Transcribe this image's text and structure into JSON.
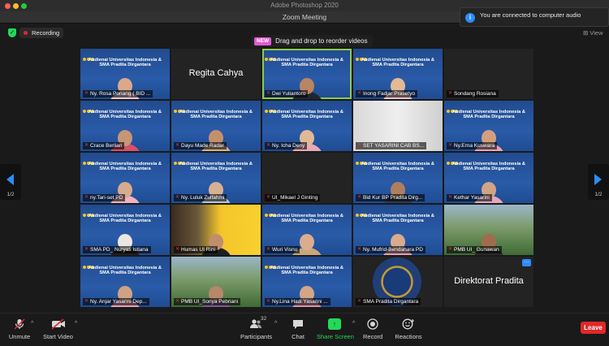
{
  "photoshop": {
    "title": "Adobe Photoshop 2020"
  },
  "window": {
    "title": "Zoom Meeting"
  },
  "notification": {
    "message_line1": "You are connected to computer audio",
    "icon": "info-icon"
  },
  "status": {
    "recording_label": "Recording",
    "view_label": "View",
    "security_icon": "shield-check-icon"
  },
  "tooltip": {
    "badge": "NEW",
    "text": "Drag and drop to reorder videos"
  },
  "banner": {
    "line1": "Audienai Universitas Indonesia &",
    "line2": "SMA Pradita Dirgantara"
  },
  "pagination": {
    "left": "1/2",
    "right": "1/2"
  },
  "tiles": [
    {
      "name": "Ny. Rosa Ponang ( BID ...",
      "kind": "banner",
      "skin": "#d9a98a",
      "cloth": "#e8c7d1"
    },
    {
      "name": "Regita Cahya",
      "kind": "name"
    },
    {
      "name": "Dwi Yuliantoro",
      "kind": "banner",
      "skin": "#b98562",
      "cloth": "#1e2634",
      "active": true
    },
    {
      "name": "Inong Fadjar Prasetyo",
      "kind": "banner",
      "skin": "#e3b996",
      "cloth": "#f1c1c8"
    },
    {
      "name": "Sondang Rosiana",
      "kind": "blank"
    },
    {
      "name": "Crace Berlian",
      "kind": "banner",
      "skin": "#c89578",
      "cloth": "#d4526b"
    },
    {
      "name": "Dayu Made Radar",
      "kind": "banner",
      "skin": "#c48f6d",
      "cloth": "#d6b18a"
    },
    {
      "name": "Ny. Icha Deny",
      "kind": "banner",
      "skin": "#e1b896",
      "cloth": "#e9a8b9"
    },
    {
      "name": "SET YASARINI CAB BS...",
      "kind": "white"
    },
    {
      "name": "Ny.Erna Kuswara",
      "kind": "banner",
      "skin": "#d3a07f",
      "cloth": "#e7a4b8"
    },
    {
      "name": "ny.Tari-set PD",
      "kind": "banner",
      "skin": "#d7ab8d",
      "cloth": "#f0b3c4"
    },
    {
      "name": "Ny. Luluk Zulfahmi",
      "kind": "banner",
      "skin": "#d9b092",
      "cloth": "#b9c6cf"
    },
    {
      "name": "UI_Mikael J Ginting",
      "kind": "blank"
    },
    {
      "name": "Bid Kur BP Pradita Dirg...",
      "kind": "banner",
      "skin": "#b07e5e",
      "cloth": "#2f3b52"
    },
    {
      "name": "Kethar Yasarini",
      "kind": "banner",
      "skin": "#d1a486",
      "cloth": "#e6a7bd"
    },
    {
      "name": "SMA PD_ Nuryati Istiana",
      "kind": "banner",
      "skin": "#ede5e2",
      "cloth": "#202020"
    },
    {
      "name": "Humas UI Rini",
      "kind": "yellow",
      "skin": "#c08e6d",
      "cloth": "#1f1f1f"
    },
    {
      "name": "Wuri Visnu",
      "kind": "banner",
      "skin": "#d9ad8e",
      "cloth": "#c9a77a"
    },
    {
      "name": "Ny. Mufrid-Bendahara PD",
      "kind": "banner",
      "skin": "#d9ac8d",
      "cloth": "#e4a3b5"
    },
    {
      "name": "PMB UI_ Gunawan",
      "kind": "green",
      "skin": "#9f6d4e",
      "cloth": "#2a2a2a"
    },
    {
      "name": "Ny. Anjar Yasarini Dep...",
      "kind": "banner",
      "skin": "#d0a283",
      "cloth": "#ec9fb9"
    },
    {
      "name": "PMB UI_Sonya Pebriani",
      "kind": "green",
      "skin": "#b7876a",
      "cloth": "#7b5b8c"
    },
    {
      "name": "Ny.Lina Hadi Yasarini ...",
      "kind": "banner",
      "skin": "#d4a687",
      "cloth": "#dc94ad"
    },
    {
      "name": "SMA Pradita Dirgantara",
      "kind": "emblem"
    },
    {
      "name": "Direktorat Pradita",
      "kind": "name",
      "more": true
    }
  ],
  "toolbar": {
    "unmute": "Unmute",
    "start_video": "Start Video",
    "participants": "Participants",
    "participants_count": "32",
    "chat": "Chat",
    "share_screen": "Share Screen",
    "record": "Record",
    "reactions": "Reactions",
    "leave": "Leave"
  },
  "colors": {
    "accent": "#2d8cff",
    "share": "#23d959",
    "leave": "#e02828",
    "active_speaker": "#8dcb4a"
  }
}
